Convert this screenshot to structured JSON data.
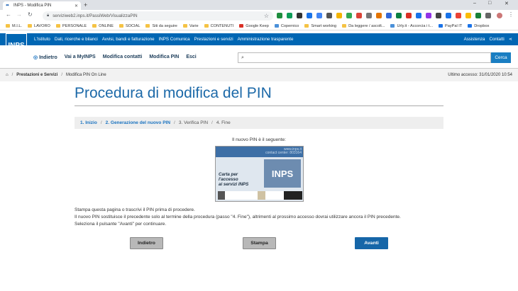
{
  "browser": {
    "tab_title": "INPS - Modifica PIN",
    "url": "serviziweb2.inps.it/PassiWeb/VisualizzaPIN",
    "new_tab": "+",
    "window_min": "–",
    "window_max": "□",
    "window_close": "✕"
  },
  "bookmarks": [
    {
      "label": "M.I.L.",
      "icon": "folder-icon"
    },
    {
      "label": "LAVORO",
      "icon": "folder-icon"
    },
    {
      "label": "PERSONALE",
      "icon": "folder-icon"
    },
    {
      "label": "ONLINE",
      "icon": "folder-icon"
    },
    {
      "label": "SOCIAL",
      "icon": "folder-icon"
    },
    {
      "label": "Siti da seguire",
      "icon": "folder-icon"
    },
    {
      "label": "Varie",
      "icon": "folder-icon"
    },
    {
      "label": "CONTENUTI",
      "icon": "folder-icon"
    },
    {
      "label": "Google Keep",
      "icon": "keep-icon"
    },
    {
      "label": "Copernico",
      "icon": "site-icon"
    },
    {
      "label": "Smart working",
      "icon": "folder-icon"
    },
    {
      "label": "Da leggere / ascolt...",
      "icon": "folder-icon"
    },
    {
      "label": "Urly.it - Accorcia i t...",
      "icon": "site-icon"
    },
    {
      "label": "PayPal IT",
      "icon": "paypal-icon"
    },
    {
      "label": "Dropbox",
      "icon": "dropbox-icon"
    }
  ],
  "inps": {
    "logo": "INPS",
    "topnav": [
      "L'Istituto",
      "Dati, ricerche e bilanci",
      "Avvisi, bandi e fatturazione",
      "INPS Comunica",
      "Prestazioni e servizi",
      "Amministrazione trasparente"
    ],
    "assistenza": "Assistenza",
    "contatti": "Contatti",
    "menu": [
      "Indietro",
      "Vai a MyINPS",
      "Modifica contatti",
      "Modifica PIN",
      "Esci"
    ],
    "search_button": "Cerca"
  },
  "breadcrumb": {
    "items": [
      "Prestazioni e Servizi",
      "Modifica PIN On Line"
    ],
    "last_access": "Ultimo accesso: 31/01/2020 10:54"
  },
  "page": {
    "title": "Procedura di modifica del PIN",
    "steps": [
      "1. Inizio",
      "2. Generazione del nuovo PIN",
      "3. Verifica PIN",
      "4. Fine"
    ],
    "pin_label": "Il nuovo PIN è il seguente:",
    "card": {
      "url": "www.inps.it",
      "contact": "contact center: 803164",
      "line1": "Carta per",
      "line2": "l'accesso",
      "line3": "ai servizi INPS",
      "brand": "INPS"
    },
    "info": [
      "Stampa questa pagina o trascrivi il PIN prima di procedere.",
      "Il nuovo PIN sostituisce il precedente solo al termine della procedura (passo \"4. Fine\"), altrimenti al prossimo accesso dovrai utilizzare ancora il PIN precedente.",
      "Seleziona il pulsante \"Avanti\" per continuare."
    ],
    "buttons": {
      "back": "Indietro",
      "print": "Stampa",
      "next": "Avanti"
    }
  },
  "colors": {
    "brand_blue": "#0066b3",
    "title_blue": "#1c69a8",
    "next_button": "#1666a8"
  }
}
